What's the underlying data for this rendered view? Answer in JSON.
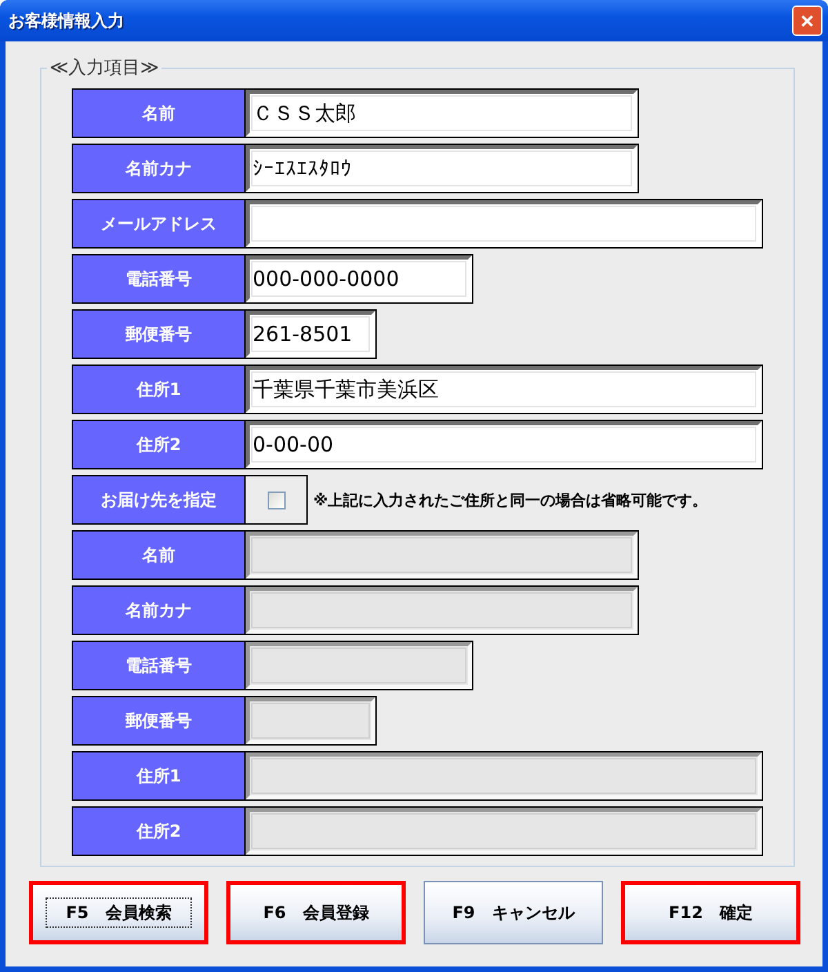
{
  "window": {
    "title": "お客様情報入力",
    "close": "✕"
  },
  "group": {
    "title": "≪入力項目≫"
  },
  "rows": [
    {
      "kind": "field",
      "label": "名前",
      "value": "ＣＳＳ太郎",
      "disabled": false
    },
    {
      "kind": "field",
      "label": "名前カナ",
      "value": "ｼｰｴｽｴｽﾀﾛｳ",
      "disabled": false
    },
    {
      "kind": "field",
      "label": "メールアドレス",
      "disabled": false
    },
    {
      "kind": "field",
      "label": "電話番号",
      "value": "000-000-0000",
      "disabled": false
    },
    {
      "kind": "field",
      "label": "郵便番号",
      "value": "261-8501",
      "disabled": false
    },
    {
      "kind": "field",
      "label": "住所1",
      "value": "千葉県千葉市美浜区",
      "disabled": false
    },
    {
      "kind": "field",
      "label": "住所2",
      "value": "0-00-00",
      "disabled": false
    },
    {
      "kind": "checkbox",
      "label": "お届け先を指定",
      "checked": false,
      "note": "※上記に入力されたご住所と同一の場合は省略可能です。"
    },
    {
      "kind": "field",
      "label": "名前",
      "disabled": true
    },
    {
      "kind": "field",
      "label": "名前カナ",
      "disabled": true
    },
    {
      "kind": "field",
      "label": "電話番号",
      "disabled": true
    },
    {
      "kind": "field",
      "label": "郵便番号",
      "disabled": true
    },
    {
      "kind": "field",
      "label": "住所1",
      "disabled": true
    },
    {
      "kind": "field",
      "label": "住所2",
      "disabled": true
    }
  ],
  "buttons": [
    {
      "label": "F5　会員検索",
      "highlighted": true,
      "focused": true
    },
    {
      "label": "F6　会員登録",
      "highlighted": true,
      "focused": false
    },
    {
      "label": "F9　キャンセル",
      "highlighted": false,
      "focused": false
    },
    {
      "label": "F12　確定",
      "highlighted": true,
      "focused": false
    }
  ]
}
